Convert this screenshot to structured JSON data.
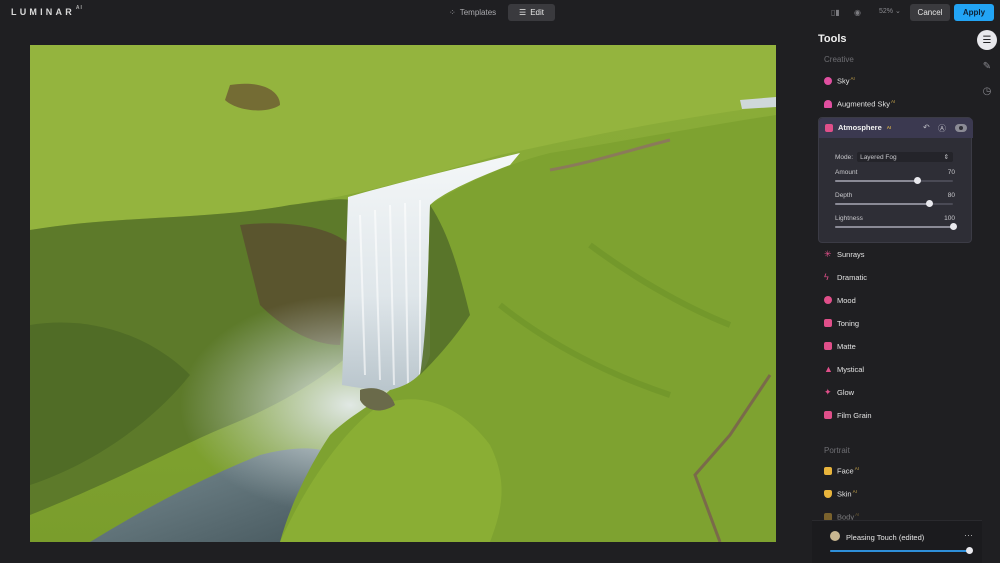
{
  "app": {
    "logo": "LUMINAR",
    "logo_suffix": "AI",
    "accent": "#22a4f5"
  },
  "topbar": {
    "templates_label": "Templates",
    "edit_label": "Edit",
    "zoom": "52%",
    "cancel_label": "Cancel",
    "apply_label": "Apply"
  },
  "panel": {
    "title": "Tools",
    "creative_label": "Creative",
    "portrait_label": "Portrait",
    "ai_badge": "AI",
    "items_top": [
      {
        "label": "Sky",
        "ai": true,
        "icon": "sky-icon",
        "color": "#e04fa0"
      },
      {
        "label": "Augmented Sky",
        "ai": true,
        "icon": "augmented-sky-icon",
        "color": "#e04fa0"
      }
    ],
    "atmosphere": {
      "label": "Atmosphere",
      "ai": true,
      "mode_label": "Mode:",
      "mode_value": "Layered Fog",
      "sliders": [
        {
          "label": "Amount",
          "value": "70",
          "fraction": 0.7
        },
        {
          "label": "Depth",
          "value": "80",
          "fraction": 0.8
        },
        {
          "label": "Lightness",
          "value": "100",
          "fraction": 1.0
        }
      ]
    },
    "items_creative": [
      {
        "label": "Sunrays",
        "icon": "sunrays-icon",
        "color": "#e04f8a"
      },
      {
        "label": "Dramatic",
        "icon": "dramatic-icon",
        "color": "#e04f8a"
      },
      {
        "label": "Mood",
        "icon": "mood-icon",
        "color": "#e04f8a"
      },
      {
        "label": "Toning",
        "icon": "toning-icon",
        "color": "#e04f8a"
      },
      {
        "label": "Matte",
        "icon": "matte-icon",
        "color": "#e04f8a"
      },
      {
        "label": "Mystical",
        "icon": "mystical-icon",
        "color": "#e04f8a"
      },
      {
        "label": "Glow",
        "icon": "glow-icon",
        "color": "#e04f8a"
      },
      {
        "label": "Film Grain",
        "icon": "film-grain-icon",
        "color": "#e04f8a"
      }
    ],
    "items_portrait": [
      {
        "label": "Face",
        "ai": true,
        "icon": "face-icon",
        "color": "#e8b43c"
      },
      {
        "label": "Skin",
        "ai": true,
        "icon": "skin-icon",
        "color": "#e8b43c"
      },
      {
        "label": "Body",
        "ai": true,
        "icon": "body-icon",
        "color": "#e8b43c"
      }
    ]
  },
  "preset": {
    "name": "Pleasing Touch (edited)",
    "more": "···",
    "amount_fraction": 1.0
  }
}
